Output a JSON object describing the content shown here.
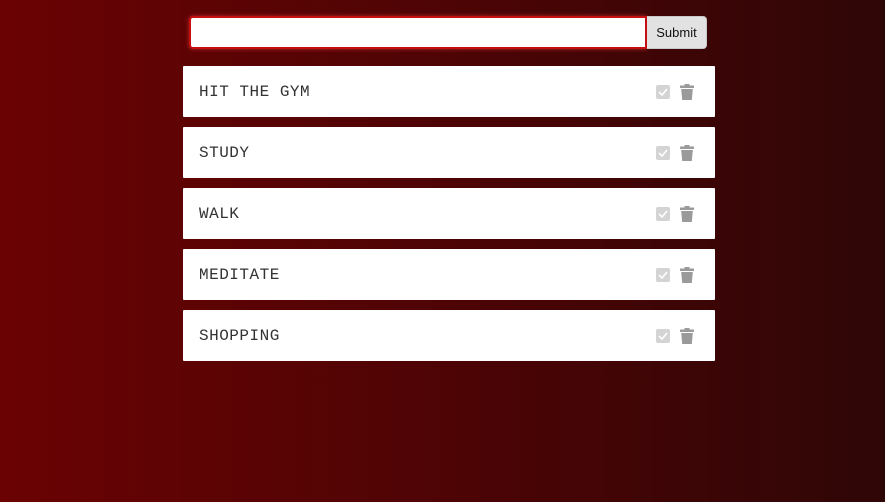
{
  "form": {
    "input_value": "",
    "input_placeholder": "",
    "submit_label": "Submit"
  },
  "todos": [
    {
      "text": "HIT THE GYM",
      "check_icon": "check-square-icon",
      "delete_icon": "trash-icon"
    },
    {
      "text": "STUDY",
      "check_icon": "check-square-icon",
      "delete_icon": "trash-icon"
    },
    {
      "text": "WALK",
      "check_icon": "check-square-icon",
      "delete_icon": "trash-icon"
    },
    {
      "text": "MEDITATE",
      "check_icon": "check-square-icon",
      "delete_icon": "trash-icon"
    },
    {
      "text": "SHOPPING",
      "check_icon": "check-square-icon",
      "delete_icon": "trash-icon"
    }
  ],
  "colors": {
    "background_start": "#6a0203",
    "background_end": "#2f0606",
    "input_border": "#c40e10",
    "icon_gray": "#9a9a9a",
    "check_gray": "#d4d4d4"
  }
}
